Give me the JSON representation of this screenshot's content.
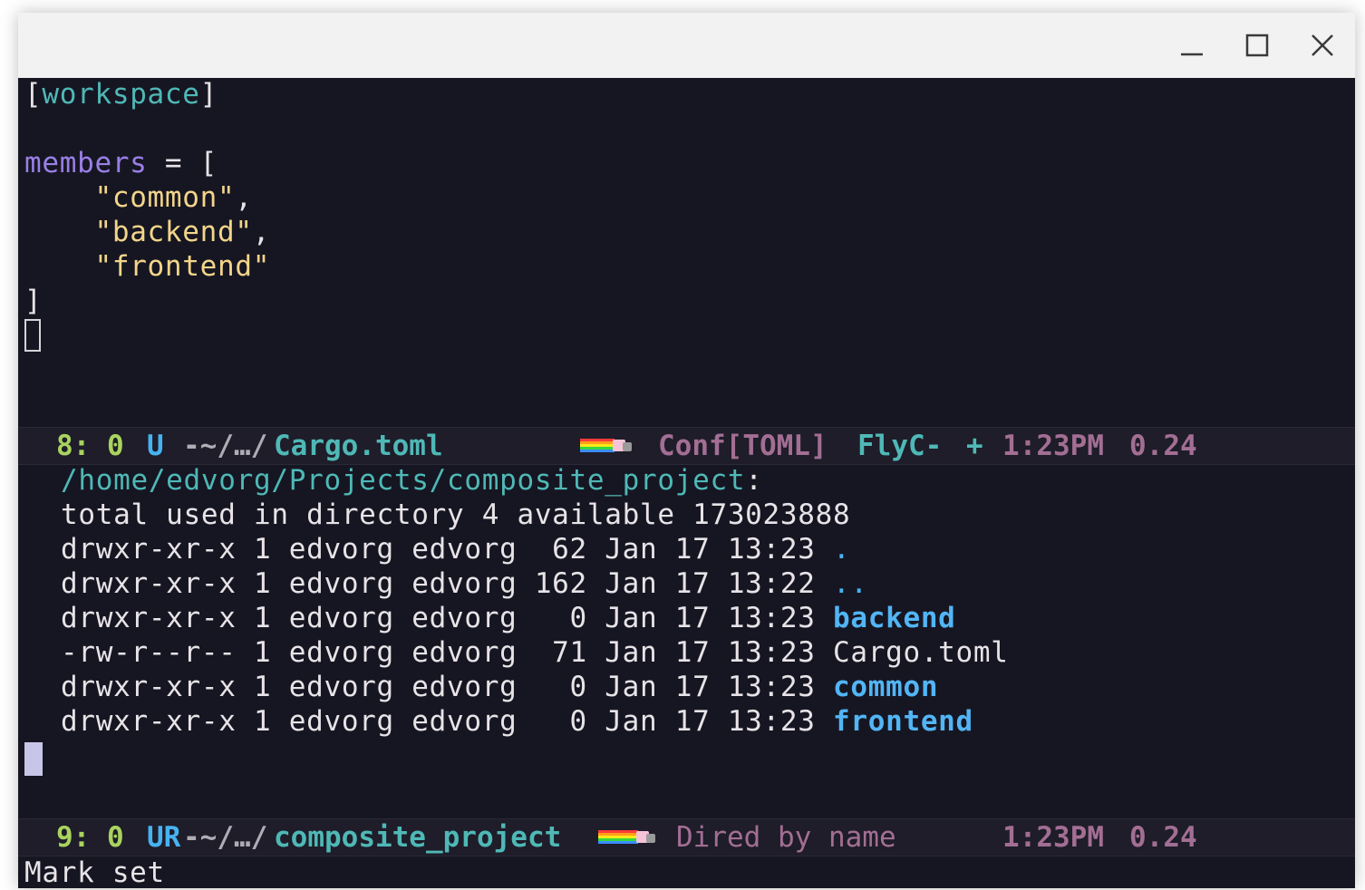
{
  "window": {
    "controls": {
      "minimize": "minimize-icon",
      "maximize": "maximize-icon",
      "close": "close-icon"
    }
  },
  "buffer_toml": {
    "lines": [
      {
        "parts": [
          {
            "text": "[",
            "color": "white"
          },
          {
            "text": "workspace",
            "color": "cyan"
          },
          {
            "text": "]",
            "color": "white"
          }
        ]
      },
      {
        "parts": []
      },
      {
        "parts": [
          {
            "text": "members",
            "color": "purple"
          },
          {
            "text": " = [",
            "color": "white"
          }
        ]
      },
      {
        "parts": [
          {
            "text": "    ",
            "color": "white"
          },
          {
            "text": "\"common\"",
            "color": "yellow"
          },
          {
            "text": ",",
            "color": "white"
          }
        ]
      },
      {
        "parts": [
          {
            "text": "    ",
            "color": "white"
          },
          {
            "text": "\"backend\"",
            "color": "yellow"
          },
          {
            "text": ",",
            "color": "white"
          }
        ]
      },
      {
        "parts": [
          {
            "text": "    ",
            "color": "white"
          },
          {
            "text": "\"frontend\"",
            "color": "yellow"
          }
        ]
      },
      {
        "parts": [
          {
            "text": "]",
            "color": "white"
          }
        ]
      }
    ]
  },
  "modeline_1": {
    "position": "8: 0",
    "state": "U",
    "path_prefix": "-~/…/",
    "filename": "Cargo.toml",
    "mode": "Conf[TOML]",
    "flycheck": "FlyC-",
    "plus": "+",
    "time": "1:23PM",
    "load": "0.24"
  },
  "dired": {
    "directory": "/home/edvorg/Projects/composite_project",
    "dir_suffix": ":",
    "summary": "total used in directory 4 available 173023888",
    "entries": [
      {
        "meta": "drwxr-xr-x 1 edvorg edvorg  62 Jan 17 13:23 ",
        "name": ".",
        "type": "dot"
      },
      {
        "meta": "drwxr-xr-x 1 edvorg edvorg 162 Jan 17 13:22 ",
        "name": "..",
        "type": "dot"
      },
      {
        "meta": "drwxr-xr-x 1 edvorg edvorg   0 Jan 17 13:23 ",
        "name": "backend",
        "type": "dir"
      },
      {
        "meta": "-rw-r--r-- 1 edvorg edvorg  71 Jan 17 13:23 ",
        "name": "Cargo.toml",
        "type": "file"
      },
      {
        "meta": "drwxr-xr-x 1 edvorg edvorg   0 Jan 17 13:23 ",
        "name": "common",
        "type": "dir"
      },
      {
        "meta": "drwxr-xr-x 1 edvorg edvorg   0 Jan 17 13:23 ",
        "name": "frontend",
        "type": "dir"
      }
    ]
  },
  "modeline_2": {
    "position": "9: 0",
    "state": "UR",
    "path_prefix": "-~/…/",
    "dirname": "composite_project",
    "mode": "Dired by name",
    "time": "1:23PM",
    "load": "0.24"
  },
  "echo_area": {
    "message": "Mark set"
  },
  "colors": {
    "background": "#161622",
    "cyan": "#4fb8b6",
    "purple": "#9a7fe6",
    "yellow": "#f3d58a",
    "green": "#a9d35f",
    "blue": "#47b2f2",
    "mauve": "#a36e94",
    "white": "#e7e3e7",
    "dir": "#52b5f5"
  }
}
